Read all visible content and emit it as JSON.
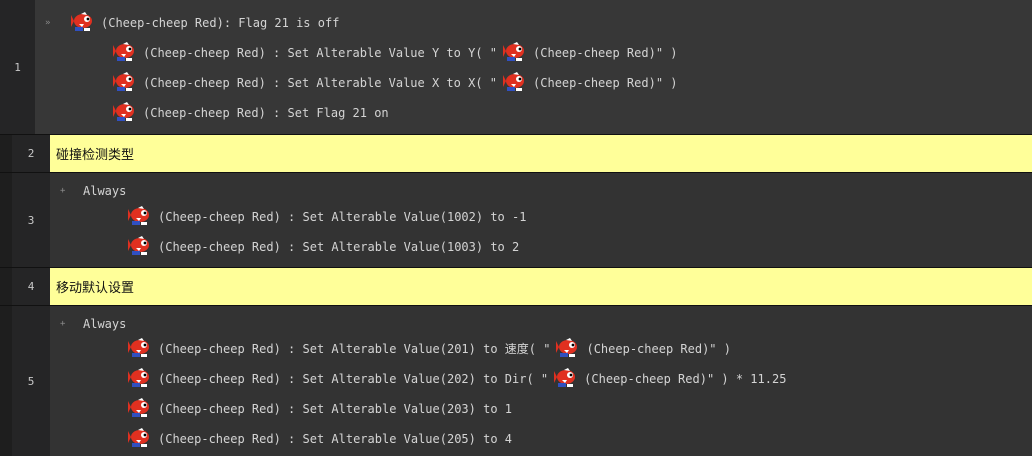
{
  "events": [
    {
      "number": "1",
      "condition": "(Cheep-cheep Red): Flag 21 is off",
      "actions": [
        {
          "pre": "(Cheep-cheep Red) : Set Alterable Value Y to Y( \"",
          "post": "(Cheep-cheep Red)\" )"
        },
        {
          "pre": "(Cheep-cheep Red) : Set Alterable Value X to X( \"",
          "post": "(Cheep-cheep Red)\" )"
        },
        {
          "pre": "(Cheep-cheep Red) : Set Flag 21 on",
          "post": ""
        }
      ]
    },
    {
      "number": "2",
      "comment": "碰撞检测类型"
    },
    {
      "number": "3",
      "condition": "Always",
      "actions": [
        {
          "pre": "(Cheep-cheep Red) : Set Alterable Value(1002) to -1",
          "post": ""
        },
        {
          "pre": "(Cheep-cheep Red) : Set Alterable Value(1003) to 2",
          "post": ""
        }
      ]
    },
    {
      "number": "4",
      "comment": "移动默认设置"
    },
    {
      "number": "5",
      "condition": "Always",
      "actions": [
        {
          "pre": "(Cheep-cheep Red) : Set Alterable Value(201) to 速度( \"",
          "post": "(Cheep-cheep Red)\" )"
        },
        {
          "pre": "(Cheep-cheep Red) : Set Alterable Value(202) to Dir( \"",
          "post": "(Cheep-cheep Red)\" ) * 11.25"
        },
        {
          "pre": "(Cheep-cheep Red) : Set Alterable Value(203) to 1",
          "post": ""
        },
        {
          "pre": "(Cheep-cheep Red) : Set Alterable Value(205) to 4",
          "post": ""
        }
      ]
    }
  ],
  "markers": {
    "event1": "»",
    "always": "+"
  },
  "colors": {
    "comment_bg": "#ffff99",
    "body_bg": "#333333",
    "sprite_red": "#e03020"
  }
}
